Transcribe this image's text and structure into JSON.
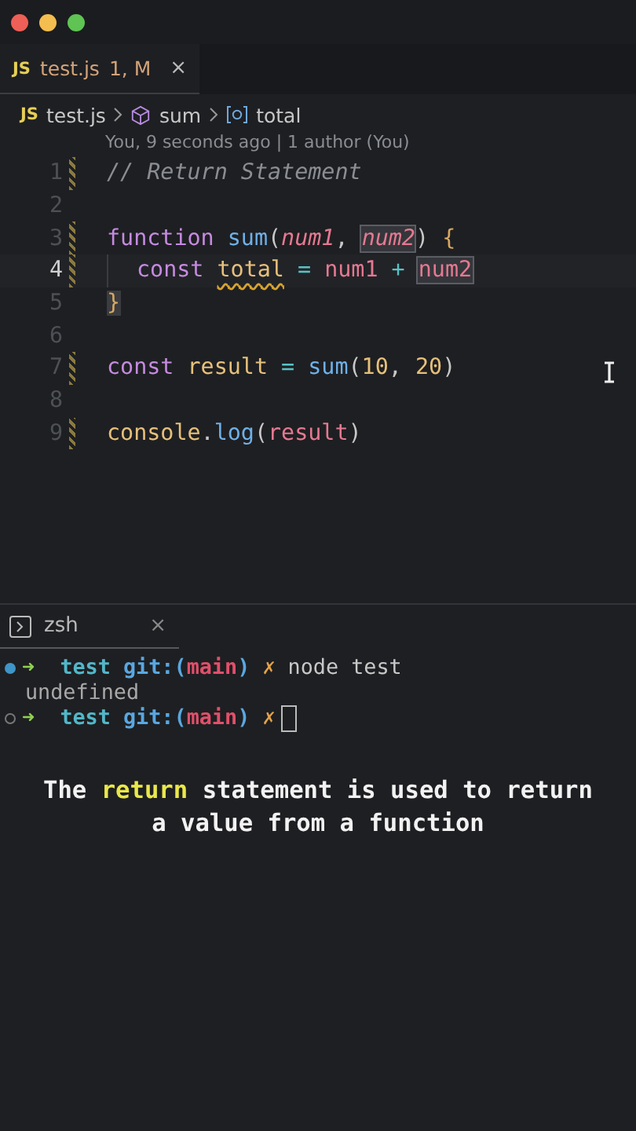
{
  "window": {
    "controls": [
      {
        "kind": "close"
      },
      {
        "kind": "minimize"
      },
      {
        "kind": "maximize"
      }
    ]
  },
  "tabs": [
    {
      "icon": "JS",
      "name": "test.js",
      "badge": "1, M",
      "close": "×",
      "selected": true
    }
  ],
  "breadcrumb": {
    "icon": "JS",
    "file": "test.js",
    "items": [
      {
        "kind": "function",
        "label": "sum"
      },
      {
        "kind": "variable",
        "label": "total"
      }
    ]
  },
  "blame": "You, 9 seconds ago | 1 author (You)",
  "code_lines": [
    {
      "number": "1",
      "modified": true,
      "current": false,
      "indented": false,
      "tokens": [
        {
          "kind": "comment",
          "text": "// Return Statement"
        }
      ]
    },
    {
      "number": "2",
      "modified": false,
      "current": false,
      "indented": false
    },
    {
      "number": "3",
      "modified": true,
      "current": false,
      "indented": false,
      "tokens": [
        {
          "kind": "keyword",
          "text": "function "
        },
        {
          "kind": "function",
          "text": "sum"
        },
        {
          "kind": "punct",
          "text": "("
        },
        {
          "kind": "param",
          "text": "num1"
        },
        {
          "kind": "punct",
          "text": ", "
        },
        {
          "kind": "param",
          "text": "num2",
          "boxed": true
        },
        {
          "kind": "punct",
          "text": ") "
        },
        {
          "kind": "brace",
          "text": "{"
        }
      ]
    },
    {
      "number": "4",
      "modified": true,
      "current": true,
      "indented": true,
      "tokens": [
        {
          "kind": "keyword",
          "text": "const "
        },
        {
          "kind": "variable",
          "text": "total",
          "squiggle": true
        },
        {
          "kind": "operator",
          "text": " = "
        },
        {
          "kind": "ref",
          "text": "num1"
        },
        {
          "kind": "operator",
          "text": " + "
        },
        {
          "kind": "ref",
          "text": "num2",
          "boxed": true
        }
      ]
    },
    {
      "number": "5",
      "modified": false,
      "current": false,
      "indented": false,
      "tokens": [
        {
          "kind": "brace",
          "text": "}",
          "shaded": true
        }
      ]
    },
    {
      "number": "6",
      "modified": false,
      "current": false,
      "indented": false
    },
    {
      "number": "7",
      "modified": true,
      "current": false,
      "indented": false,
      "tokens": [
        {
          "kind": "keyword",
          "text": "const "
        },
        {
          "kind": "variable",
          "text": "result"
        },
        {
          "kind": "operator",
          "text": " = "
        },
        {
          "kind": "function",
          "text": "sum"
        },
        {
          "kind": "punct",
          "text": "("
        },
        {
          "kind": "number",
          "text": "10"
        },
        {
          "kind": "punct",
          "text": ", "
        },
        {
          "kind": "number",
          "text": "20"
        },
        {
          "kind": "punct",
          "text": ")"
        }
      ]
    },
    {
      "number": "8",
      "modified": false,
      "current": false,
      "indented": false
    },
    {
      "number": "9",
      "modified": true,
      "current": false,
      "indented": false,
      "tokens": [
        {
          "kind": "variable",
          "text": "console"
        },
        {
          "kind": "punct",
          "text": "."
        },
        {
          "kind": "function",
          "text": "log"
        },
        {
          "kind": "punct",
          "text": "("
        },
        {
          "kind": "ref",
          "text": "result"
        },
        {
          "kind": "punct",
          "text": ")"
        }
      ]
    }
  ],
  "terminal": {
    "tab": {
      "label": "zsh",
      "close": "×",
      "selected": true
    },
    "lines": [
      {
        "kind": "prompt",
        "finished": true,
        "arrow": "➜",
        "dir": "test",
        "git": "git:(",
        "branch": "main",
        "close": ")",
        "dirty": "✗",
        "command": "node test",
        "cursor": false
      },
      {
        "kind": "output",
        "text": "undefined"
      },
      {
        "kind": "prompt",
        "finished": false,
        "arrow": "➜",
        "dir": "test",
        "git": "git:(",
        "branch": "main",
        "close": ")",
        "dirty": "✗",
        "cursor": true
      }
    ]
  },
  "caption": {
    "segments": [
      {
        "text": "The ",
        "highlight": false
      },
      {
        "text": "return",
        "highlight": true
      },
      {
        "text": " statement is used to return a value from a function",
        "highlight": false
      }
    ]
  }
}
